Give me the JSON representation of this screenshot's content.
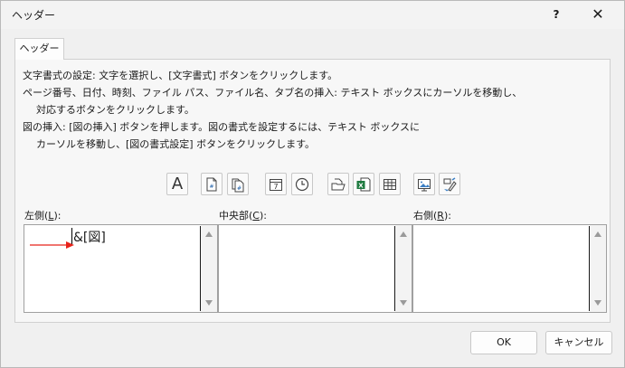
{
  "window": {
    "title": "ヘッダー",
    "help_label": "?",
    "close_label": "✕"
  },
  "tab": {
    "label": "ヘッダー"
  },
  "instructions": [
    "文字書式の設定: 文字を選択し、[文字書式] ボタンをクリックします。",
    "ページ番号、日付、時刻、ファイル パス、ファイル名、タブ名の挿入: テキスト ボックスにカーソルを移動し、",
    "対応するボタンをクリックします。",
    "図の挿入: [図の挿入] ボタンを押します。図の書式を設定するには、テキスト ボックスに",
    "カーソルを移動し、[図の書式設定] ボタンをクリックします。"
  ],
  "toolbar": {
    "buttons": [
      {
        "name": "format-text",
        "icon": "text-A-icon"
      },
      {
        "name": "insert-page-number",
        "icon": "page-number-icon"
      },
      {
        "name": "insert-number-of-pages",
        "icon": "pages-icon"
      },
      {
        "name": "insert-date",
        "icon": "calendar-icon"
      },
      {
        "name": "insert-time",
        "icon": "clock-icon"
      },
      {
        "name": "insert-file-path",
        "icon": "folder-icon"
      },
      {
        "name": "insert-file-name",
        "icon": "excel-file-icon"
      },
      {
        "name": "insert-sheet-name",
        "icon": "sheet-grid-icon"
      },
      {
        "name": "insert-picture",
        "icon": "picture-icon"
      },
      {
        "name": "format-picture",
        "icon": "format-picture-icon"
      }
    ],
    "text_button_label": "A",
    "calendar_day": "7"
  },
  "sections": {
    "left": {
      "label_prefix": "左側(",
      "accel": "L",
      "label_suffix": "):",
      "content": "&[図]"
    },
    "center": {
      "label_prefix": "中央部(",
      "accel": "C",
      "label_suffix": "):",
      "content": ""
    },
    "right": {
      "label_prefix": "右側(",
      "accel": "R",
      "label_suffix": "):",
      "content": ""
    }
  },
  "colors": {
    "annotation_arrow": "#e8231a",
    "excel_green": "#1d7a3f"
  },
  "footer": {
    "ok_label": "OK",
    "cancel_label": "キャンセル"
  }
}
